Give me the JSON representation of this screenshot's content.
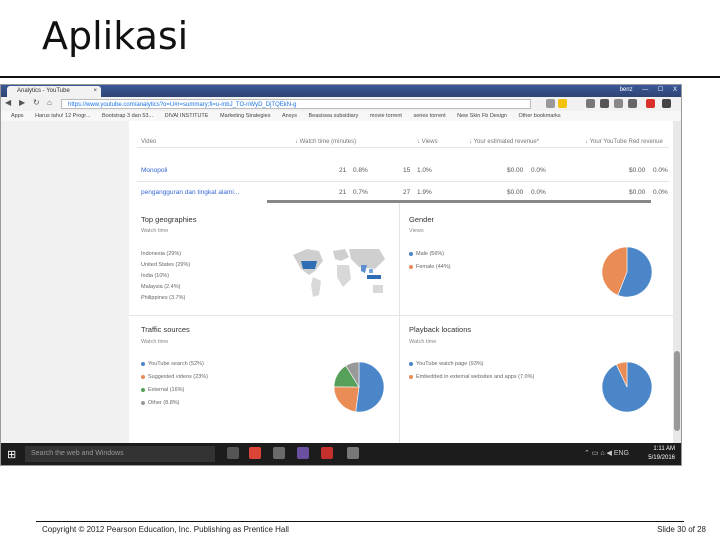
{
  "slide": {
    "title": "Aplikasi",
    "footer_left": "Copyright © 2012 Pearson Education, Inc. Publishing as Prentice Hall",
    "footer_right": "Slide 30 of 28"
  },
  "browser": {
    "tab_title": "Analytics - YouTube",
    "tab_close": "×",
    "window_controls": [
      "—",
      "☐",
      "X"
    ],
    "user_badge": "benz",
    "url": "https://www.youtube.com/analytics?o=U#r=summary;fi=u-mbJ_TO-nWyD_DjTQEkN-g",
    "bookmarks": [
      "Apps",
      "Harus tahu! 12 Progr...",
      "Bootstrap 3 dan 53...",
      "DIVAI INSTITUTE",
      "Marketing Strategies",
      "Ansys",
      "Beasiswa subsidiary",
      "movie torrent",
      "series torrent",
      "New Skin Fb Design",
      "Other bookmarks"
    ]
  },
  "table": {
    "headers": {
      "video": "Video",
      "watch_time": "Watch time (minutes)",
      "views": "Views",
      "revenue": "Your estimated revenue*",
      "red_revenue": "Your YouTube Red revenue"
    },
    "rows": [
      {
        "video": "Monopoli",
        "watch_time": "21",
        "watch_pct": "0.8%",
        "views": "15",
        "views_pct": "1.0%",
        "revenue": "$0.00",
        "revenue_pct": "0.0%",
        "red": "$0.00",
        "red_pct": "0.0%"
      },
      {
        "video": "pengangguran dan tingkat alami...",
        "watch_time": "21",
        "watch_pct": "0.7%",
        "views": "27",
        "views_pct": "1.9%",
        "revenue": "$0.00",
        "revenue_pct": "0.0%",
        "red": "$0.00",
        "red_pct": "0.0%"
      }
    ]
  },
  "geographies": {
    "title": "Top geographies",
    "subtitle": "Watch time",
    "items": [
      "Indonesia (29%)",
      "United States (29%)",
      "India (10%)",
      "Malaysia (2.4%)",
      "Philippines (3.7%)"
    ]
  },
  "gender": {
    "title": "Gender",
    "subtitle": "Views",
    "items": [
      {
        "label": "Male (56%)",
        "value": 56,
        "color": "#4a86c8"
      },
      {
        "label": "Female (44%)",
        "value": 44,
        "color": "#ea8c55"
      }
    ]
  },
  "traffic": {
    "title": "Traffic sources",
    "subtitle": "Watch time",
    "items": [
      {
        "label": "YouTube search (52%)",
        "value": 52,
        "color": "#4a86c8"
      },
      {
        "label": "Suggested videos (23%)",
        "value": 23,
        "color": "#ea8c55"
      },
      {
        "label": "External (16%)",
        "value": 16,
        "color": "#57a05a"
      },
      {
        "label": "Other (8.8%)",
        "value": 8.8,
        "color": "#999999"
      }
    ]
  },
  "playback": {
    "title": "Playback locations",
    "subtitle": "Watch time",
    "items": [
      {
        "label": "YouTube watch page (93%)",
        "value": 93,
        "color": "#4a86c8"
      },
      {
        "label": "Embedded in external websites and apps (7.0%)",
        "value": 7,
        "color": "#ea8c55"
      }
    ]
  },
  "taskbar": {
    "search_placeholder": "Search the web and Windows",
    "tray": "⌃ ▭ ⌂ ◀ ENG",
    "time": "1:11 AM",
    "date": "5/19/2016"
  }
}
